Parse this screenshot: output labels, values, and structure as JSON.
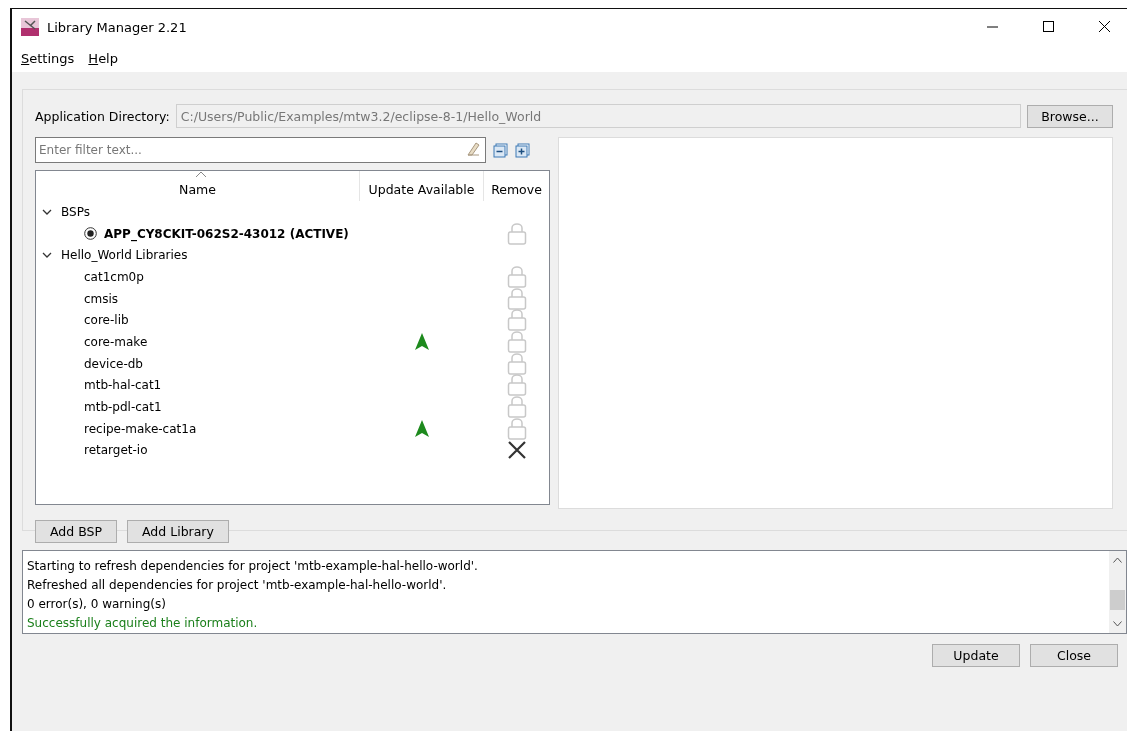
{
  "window": {
    "title": "Library Manager 2.21"
  },
  "menu": [
    {
      "label": "Settings"
    },
    {
      "label": "Help"
    }
  ],
  "app_directory": {
    "label": "Application Directory:",
    "value": "C:/Users/Public/Examples/mtw3.2/eclipse-8-1/Hello_World",
    "button": "Browse..."
  },
  "filter": {
    "placeholder": "Enter filter text..."
  },
  "tree": {
    "columns": [
      "Name",
      "Update Available",
      "Remove"
    ],
    "groups": [
      {
        "label": "BSPs",
        "expanded": true,
        "children": [
          {
            "name": "APP_CY8CKIT-062S2-43012 (ACTIVE)",
            "kind": "bsp",
            "selected": true,
            "update_available": false,
            "locked": true
          }
        ]
      },
      {
        "label": "Hello_World Libraries",
        "expanded": true,
        "children": [
          {
            "name": "cat1cm0p",
            "kind": "lib",
            "update_available": false,
            "locked": true
          },
          {
            "name": "cmsis",
            "kind": "lib",
            "update_available": false,
            "locked": true
          },
          {
            "name": "core-lib",
            "kind": "lib",
            "update_available": false,
            "locked": true
          },
          {
            "name": "core-make",
            "kind": "lib",
            "update_available": true,
            "locked": true
          },
          {
            "name": "device-db",
            "kind": "lib",
            "update_available": false,
            "locked": true
          },
          {
            "name": "mtb-hal-cat1",
            "kind": "lib",
            "update_available": false,
            "locked": true
          },
          {
            "name": "mtb-pdl-cat1",
            "kind": "lib",
            "update_available": false,
            "locked": true
          },
          {
            "name": "recipe-make-cat1a",
            "kind": "lib",
            "update_available": true,
            "locked": true
          },
          {
            "name": "retarget-io",
            "kind": "lib",
            "update_available": false,
            "locked": false
          }
        ]
      }
    ]
  },
  "tree_buttons": [
    "Add BSP",
    "Add Library"
  ],
  "log": [
    {
      "text": "Starting to refresh dependencies for project 'mtb-example-hal-hello-world'.",
      "kind": "info"
    },
    {
      "text": "Refreshed all dependencies for project 'mtb-example-hal-hello-world'.",
      "kind": "info"
    },
    {
      "text": "0 error(s), 0 warning(s)",
      "kind": "info"
    },
    {
      "text": "Successfully acquired the information.",
      "kind": "success"
    }
  ],
  "footer_buttons": [
    "Update",
    "Close"
  ]
}
